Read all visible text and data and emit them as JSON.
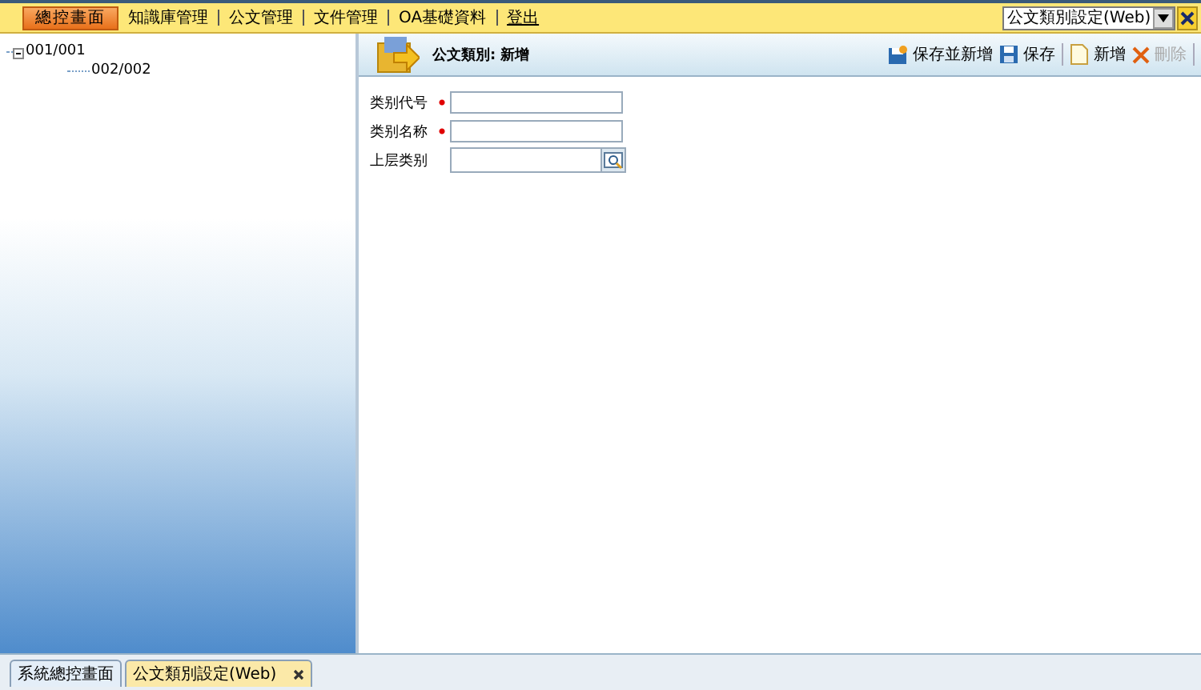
{
  "top_menu": [
    {
      "label": "總控畫面",
      "kind": "primary"
    },
    {
      "label": "知識庫管理",
      "kind": "link"
    },
    {
      "label": "公文管理",
      "kind": "link"
    },
    {
      "label": "文件管理",
      "kind": "link"
    },
    {
      "label": "OA基礎資料",
      "kind": "link"
    },
    {
      "label": "登出",
      "kind": "logout"
    }
  ],
  "window_select": {
    "value": "公文類別設定(Web)"
  },
  "tree": [
    {
      "label": "001/001",
      "expanded": true,
      "children": [
        {
          "label": "002/002"
        }
      ]
    }
  ],
  "form": {
    "title": "公文類別: 新增",
    "toolbar": [
      {
        "label": "保存並新增",
        "disabled": false
      },
      {
        "label": "保存",
        "disabled": false
      },
      {
        "label": "新增",
        "disabled": false
      },
      {
        "label": "刪除",
        "disabled": true
      }
    ],
    "fields": [
      {
        "label": "类别代号",
        "required": true,
        "kind": "text"
      },
      {
        "label": "类别名称",
        "required": true,
        "kind": "text"
      },
      {
        "label": "上层类别",
        "required": false,
        "kind": "lookup"
      }
    ]
  },
  "bottom_tabs": [
    {
      "label": "系統總控畫面",
      "selected": false,
      "closable": false
    },
    {
      "label": "公文類別設定(Web)",
      "selected": true,
      "closable": true
    }
  ]
}
